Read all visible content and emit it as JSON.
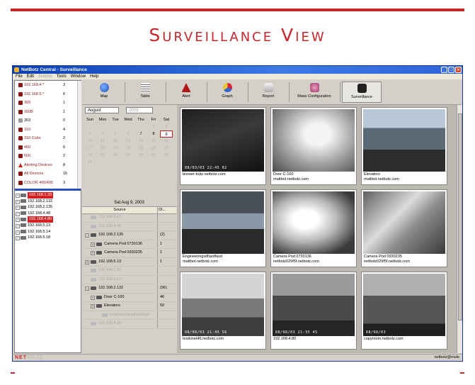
{
  "slide": {
    "title": "Surveillance View",
    "accent": "#c8262d"
  },
  "window": {
    "title": "NetBotz Central - Surveillance"
  },
  "menu": [
    {
      "label": "File",
      "enabled": true
    },
    {
      "label": "Edit",
      "enabled": true
    },
    {
      "label": "Actions",
      "enabled": false
    },
    {
      "label": "Tools",
      "enabled": true
    },
    {
      "label": "Window",
      "enabled": true
    },
    {
      "label": "Help",
      "enabled": true
    }
  ],
  "device_groups": [
    {
      "label": "192.168.4.*",
      "count": "3",
      "icon": "device"
    },
    {
      "label": "192.168.5.*",
      "count": "6",
      "icon": "device"
    },
    {
      "label": "300",
      "count": "1",
      "icon": "device"
    },
    {
      "label": "300B",
      "count": "1",
      "icon": "device"
    },
    {
      "label": "303",
      "count": "0",
      "icon": "device-grey",
      "black": true
    },
    {
      "label": "310",
      "count": "4",
      "icon": "device"
    },
    {
      "label": "310 Color",
      "count": "2",
      "icon": "device"
    },
    {
      "label": "400",
      "count": "6",
      "icon": "device"
    },
    {
      "label": "500",
      "count": "2",
      "icon": "device"
    },
    {
      "label": "Alerting Devices",
      "count": "8",
      "icon": "alert"
    },
    {
      "label": "All Devices",
      "count": "15",
      "icon": "device"
    },
    {
      "label": "COLOR 400/405",
      "count": "3",
      "icon": "device"
    },
    {
      "label": "No Camera",
      "count": "0",
      "icon": "device-grey",
      "black": true
    }
  ],
  "device_tree": [
    {
      "ip": "192.168.1.33",
      "alert": true
    },
    {
      "ip": "192.168.2.132",
      "alert": false
    },
    {
      "ip": "192.168.2.135",
      "alert": false
    },
    {
      "ip": "192.168.4.48",
      "alert": false
    },
    {
      "ip": "192.168.4.80",
      "alert": true
    },
    {
      "ip": "192.168.5.13",
      "alert": false
    },
    {
      "ip": "192.168.5.14",
      "alert": false
    },
    {
      "ip": "192.168.5.18",
      "alert": false
    }
  ],
  "toolbar": [
    {
      "label": "Map",
      "icon": "globe-icon"
    },
    {
      "label": "Table",
      "icon": "table-icon"
    },
    {
      "label": "Alert",
      "icon": "alert-icon"
    },
    {
      "label": "Graph",
      "icon": "graph-icon"
    },
    {
      "label": "Report",
      "icon": "report-icon"
    },
    {
      "label": "Mass Configuration",
      "icon": "config-icon"
    },
    {
      "label": "Surveillance",
      "icon": "camera-icon",
      "active": true
    }
  ],
  "calendar": {
    "month": "August",
    "year": "2003",
    "weekdays": [
      "Sun",
      "Mon",
      "Tue",
      "Wed",
      "Thu",
      "Fri",
      "Sat"
    ],
    "selected_day": "9",
    "active_days": [
      "7",
      "8",
      "9"
    ],
    "selected_date": "Sat Aug 9, 2003"
  },
  "source_table": {
    "col_source": "Source",
    "col_count": "Ol...",
    "rows": [
      {
        "label": "192.168.5.13",
        "value": "",
        "level": 0,
        "dim": true
      },
      {
        "label": "192.168.4.48",
        "value": "",
        "level": 0,
        "dim": true
      },
      {
        "label": "192.168.2.135",
        "value": "(2)",
        "level": 0,
        "dim": false,
        "expand": "-"
      },
      {
        "label": "Camera Pod 0730136",
        "value": "1",
        "level": 1,
        "dim": false,
        "expand": "+"
      },
      {
        "label": "Camera Pod 0930235",
        "value": "1",
        "level": 1,
        "dim": false,
        "expand": "+"
      },
      {
        "label": "192.168.5.13",
        "value": "1",
        "level": 0,
        "dim": false,
        "expand": "+"
      },
      {
        "label": "192.168.1.33",
        "value": "",
        "level": 0,
        "dim": true
      },
      {
        "label": "192.168.5.14",
        "value": "",
        "level": 0,
        "dim": true
      },
      {
        "label": "192.168.2.132",
        "value": "(96)",
        "level": 0,
        "dim": false,
        "expand": "-"
      },
      {
        "label": "Door C-100",
        "value": "46",
        "level": 1,
        "dim": false,
        "expand": "+"
      },
      {
        "label": "Elevators",
        "value": "50",
        "level": 1,
        "dim": false,
        "expand": "+"
      },
      {
        "label": "Engineeringsdfasdfasd",
        "value": "",
        "level": 2,
        "dim": true
      },
      {
        "label": "192.168.4.80",
        "value": "",
        "level": 0,
        "dim": true
      }
    ]
  },
  "cameras": [
    {
      "line1": "brewer-botz.netbotz.com",
      "line2": "",
      "stamp": "08/03/03  22:45  02",
      "scene": "dark"
    },
    {
      "line1": "Door C-100",
      "line2": "mattbot.netbotz.com",
      "stamp": "",
      "scene": "door"
    },
    {
      "line1": "Elevators",
      "line2": "mattbot.netbotz.com",
      "stamp": "",
      "scene": "office"
    },
    {
      "line1": "Engineeringsdfasdfasd",
      "line2": "mattbot.netbotz.com",
      "stamp": "",
      "scene": "engineering"
    },
    {
      "line1": "Camera Pod 0730136",
      "line2": "netbotz029f5f.netbotz.com",
      "stamp": "",
      "scene": "bright"
    },
    {
      "line1": "Camera Pod 0930235",
      "line2": "netbotz029f5f.netbotz.com",
      "stamp": "",
      "scene": "desk"
    },
    {
      "line1": "testkinet46.netbotz.com",
      "line2": "",
      "stamp": "08/08/03  21:45  56",
      "scene": "ceiling"
    },
    {
      "line1": "192.168.4.80",
      "line2": "",
      "stamp": "08/08/03  21:35  45",
      "scene": "cubicle"
    },
    {
      "line1": "copyroom.netbotz.com",
      "line2": "",
      "stamp": "08/08/03",
      "scene": "copyroom"
    }
  ],
  "status": {
    "logo_main": "NET",
    "logo_sub": "BOTZ",
    "user": "netbotz@mule"
  }
}
